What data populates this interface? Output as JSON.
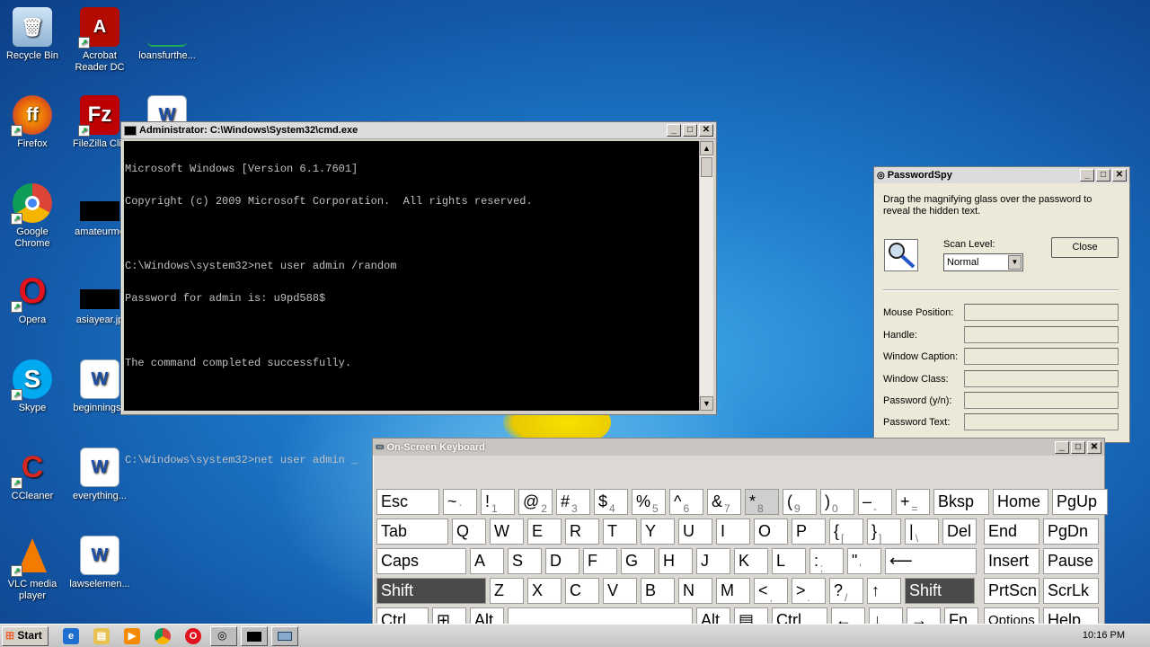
{
  "desktop": {
    "icons": [
      {
        "label": "Recycle Bin",
        "icon": "recycle-bin-icon"
      },
      {
        "label": "Acrobat Reader DC",
        "label2": "Reader DC",
        "label1": "Acrobat",
        "icon": "acrobat-icon"
      },
      {
        "label": "loansfurthe...",
        "icon": "file-icon"
      },
      {
        "label": "Firefox",
        "icon": "firefox-icon"
      },
      {
        "label": "FileZilla Clie",
        "icon": "filezilla-icon"
      },
      {
        "label": "",
        "icon": "word-doc-icon"
      },
      {
        "label": "Google Chrome",
        "label1": "Google",
        "label2": "Chrome",
        "icon": "chrome-icon"
      },
      {
        "label": "amateurmo",
        "icon": "image-file-icon"
      },
      {
        "label": "Opera",
        "icon": "opera-icon"
      },
      {
        "label": "asiayear.jp",
        "icon": "image-file-icon"
      },
      {
        "label": "Skype",
        "icon": "skype-icon"
      },
      {
        "label": "beginningse",
        "icon": "word-doc-icon"
      },
      {
        "label": "CCleaner",
        "icon": "ccleaner-icon"
      },
      {
        "label": "everything...",
        "icon": "word-doc-icon"
      },
      {
        "label": "VLC media player",
        "label1": "VLC media",
        "label2": "player",
        "icon": "vlc-icon"
      },
      {
        "label": "lawselemen...",
        "icon": "word-doc-icon"
      }
    ]
  },
  "cmd": {
    "title": "Administrator: C:\\Windows\\System32\\cmd.exe",
    "lines": [
      "Microsoft Windows [Version 6.1.7601]",
      "Copyright (c) 2009 Microsoft Corporation.  All rights reserved.",
      "",
      "C:\\Windows\\system32>net user admin /random",
      "Password for admin is: u9pd588$",
      "",
      "The command completed successfully.",
      "",
      "",
      "C:\\Windows\\system32>net user admin _"
    ]
  },
  "pwspy": {
    "title": "PasswordSpy",
    "description": "Drag the magnifying glass over the password to reveal the hidden text.",
    "scan_label": "Scan Level:",
    "scan_value": "Normal",
    "close_label": "Close",
    "fields": [
      "Mouse Position:",
      "Handle:",
      "Window Caption:",
      "Window Class:",
      "Password (y/n):",
      "Password Text:"
    ]
  },
  "osk": {
    "title": "On-Screen Keyboard",
    "rows": [
      [
        "Esc",
        "~",
        "!",
        "@",
        "#",
        "$",
        "%",
        "^",
        "&",
        "*",
        "(",
        ")",
        "–",
        "+",
        "Bksp",
        "Home",
        "PgUp"
      ],
      [
        "Tab",
        "Q",
        "W",
        "E",
        "R",
        "T",
        "Y",
        "U",
        "I",
        "O",
        "P",
        "{",
        "}",
        "|",
        "Del",
        "End",
        "PgDn"
      ],
      [
        "Caps",
        "A",
        "S",
        "D",
        "F",
        "G",
        "H",
        "J",
        "K",
        "L",
        ":",
        "\"",
        "⟵",
        "Insert",
        "Pause"
      ],
      [
        "Shift",
        "Z",
        "X",
        "C",
        "V",
        "B",
        "N",
        "M",
        "<",
        ">",
        "?",
        "↑",
        "Shift",
        "PrtScn",
        "ScrLk"
      ],
      [
        "Ctrl",
        "⊞",
        "Alt",
        "",
        "Alt",
        "▤",
        "Ctrl",
        "←",
        "↓",
        "→",
        "Fn",
        "Options",
        "Help"
      ]
    ],
    "subs": {
      "~": "`",
      "!": "1",
      "@": "2",
      "#": "3",
      "$": "4",
      "%": "5",
      "^": "6",
      "&": "7",
      "*": "8",
      "(": "9",
      ")": "0",
      "–": "-",
      "+": "=",
      "{": "[",
      "}": "]",
      "|": "\\",
      ":": ";",
      "\"": "'",
      "<": ",",
      ">": ".",
      "?": "/"
    }
  },
  "taskbar": {
    "start_label": "Start",
    "clock": "10:16 PM"
  }
}
